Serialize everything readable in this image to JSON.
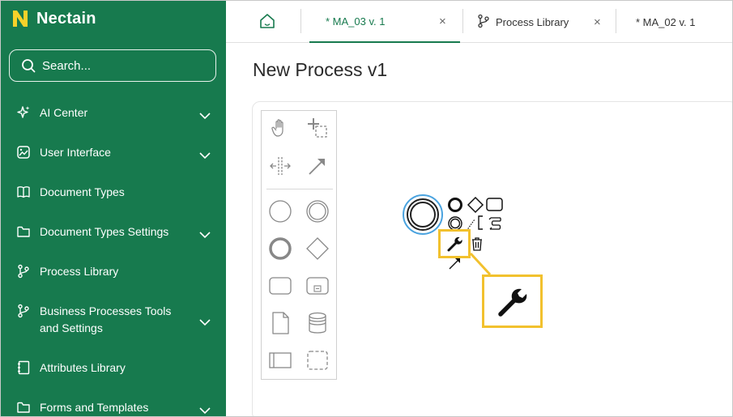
{
  "app": {
    "brand": "Nectain",
    "brand_color": "#177a4e",
    "accent_color": "#f2c12e"
  },
  "search": {
    "placeholder": "Search..."
  },
  "sidebar": {
    "items": [
      {
        "label": "AI Center",
        "icon": "sparkle-icon",
        "has_chevron": true
      },
      {
        "label": "User Interface",
        "icon": "image-icon",
        "has_chevron": true
      },
      {
        "label": "Document Types",
        "icon": "book-icon",
        "has_chevron": false
      },
      {
        "label": "Document Types Settings",
        "icon": "folder-icon",
        "has_chevron": true
      },
      {
        "label": "Process Library",
        "icon": "branch-icon",
        "has_chevron": false
      },
      {
        "label": "Business Processes Tools and Settings",
        "icon": "branch-icon",
        "has_chevron": true
      },
      {
        "label": "Attributes Library",
        "icon": "notebook-icon",
        "has_chevron": false
      },
      {
        "label": "Forms and Templates",
        "icon": "folder-icon",
        "has_chevron": true
      }
    ]
  },
  "tabs": [
    {
      "label": "* MA_03 v. 1",
      "active": true,
      "close": "×"
    },
    {
      "label": "Process Library",
      "active": false,
      "close": "×"
    },
    {
      "label": "* MA_02 v. 1",
      "active": false
    }
  ],
  "main": {
    "title": "New Process v1"
  },
  "palette": {
    "tools": [
      "hand-tool-icon",
      "lasso-tool-icon",
      "space-tool-icon",
      "connect-tool-icon",
      "start-event-icon",
      "intermediate-event-icon",
      "end-event-icon",
      "gateway-icon",
      "task-icon",
      "subprocess-icon",
      "data-object-icon",
      "data-store-icon",
      "pool-icon",
      "group-icon"
    ]
  },
  "context_pad": {
    "actions": [
      "append-end-event-icon",
      "append-gateway-icon",
      "append-task-icon",
      "append-intermediate-event-icon",
      "text-annotation-icon",
      "change-type-icon",
      "wrench-icon",
      "delete-icon",
      "connect-icon"
    ]
  }
}
